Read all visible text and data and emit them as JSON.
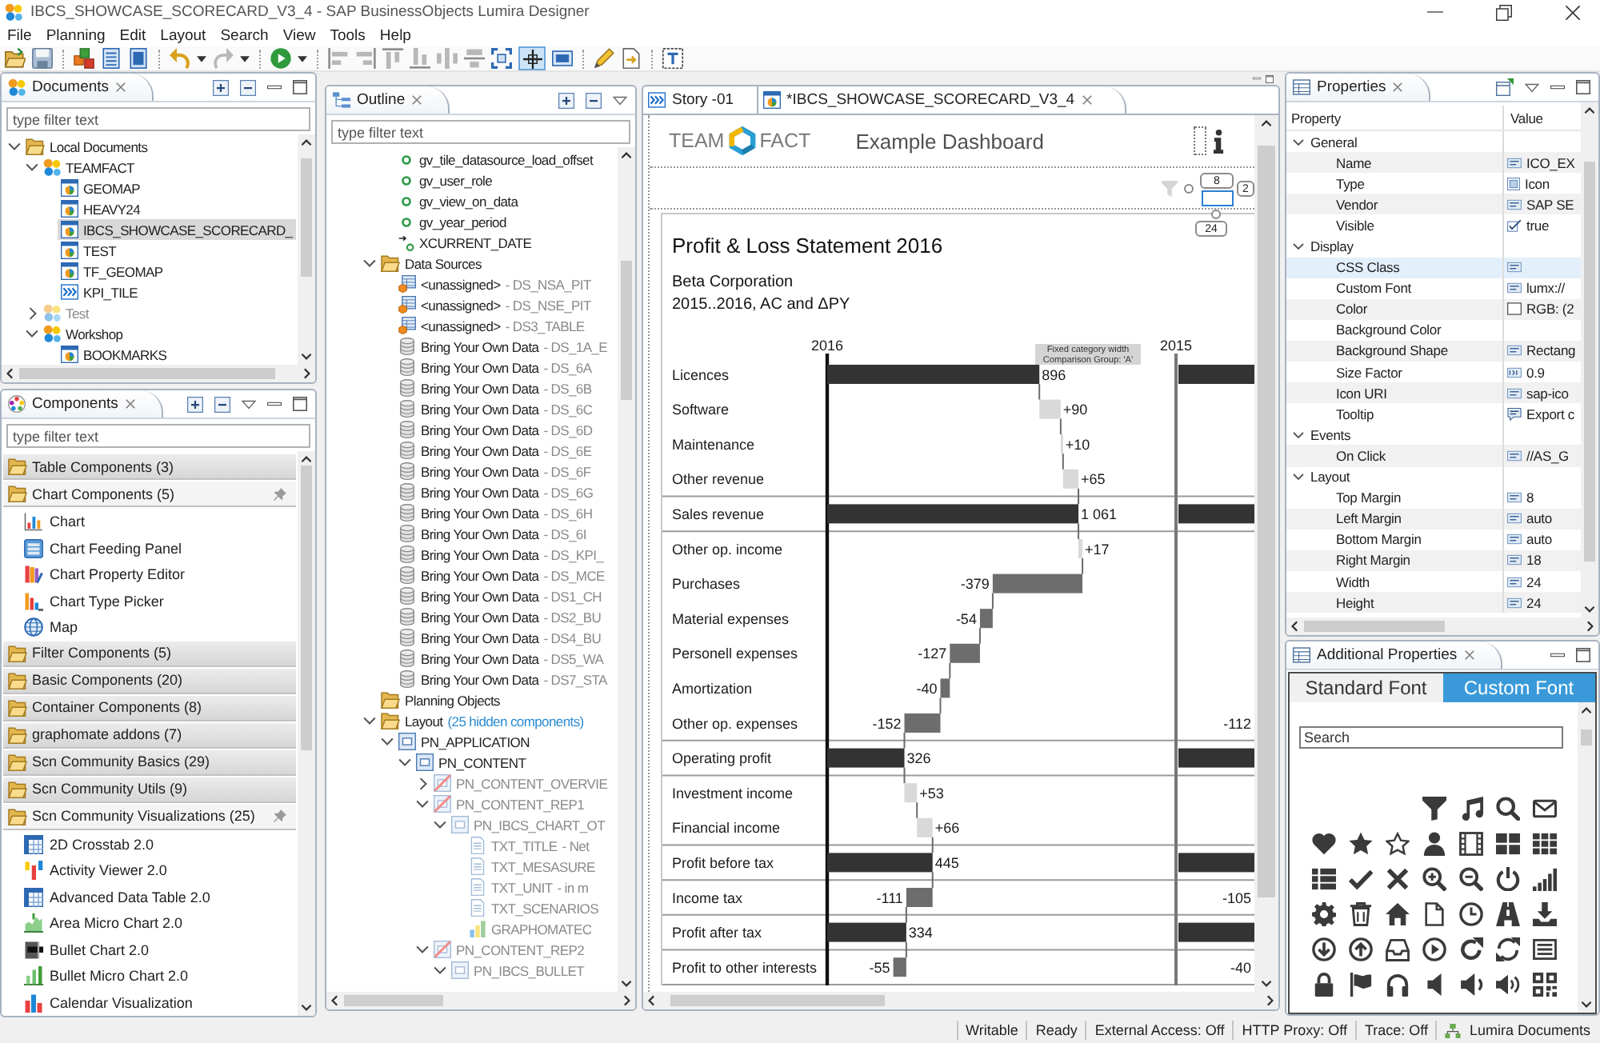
{
  "window": {
    "title": "IBCS_SHOWCASE_SCORECARD_V3_4 - SAP BusinessObjects Lumira Designer"
  },
  "menu": [
    "File",
    "Planning",
    "Edit",
    "Layout",
    "Search",
    "View",
    "Tools",
    "Help"
  ],
  "toolbar": {
    "toggle": {
      "on": true
    }
  },
  "documents": {
    "title": "Documents",
    "filter": {
      "placeholder": "type filter text"
    },
    "tree": [
      {
        "label": "Local Documents",
        "kind": "folder",
        "expanded": true,
        "selected": false,
        "children": [
          {
            "label": "TEAMFACT",
            "kind": "group",
            "expanded": true,
            "selected": false,
            "disabled": false,
            "children": [
              {
                "label": "GEOMAP",
                "kind": "app",
                "selected": false
              },
              {
                "label": "HEAVY24",
                "kind": "app",
                "selected": false
              },
              {
                "label": "IBCS_SHOWCASE_SCORECARD_",
                "kind": "app",
                "selected": true
              },
              {
                "label": "TEST",
                "kind": "app",
                "selected": false
              },
              {
                "label": "TF_GEOMAP",
                "kind": "app",
                "selected": false
              },
              {
                "label": "KPI_TILE",
                "kind": "story",
                "selected": false
              }
            ]
          },
          {
            "label": "Test",
            "kind": "group",
            "expanded": false,
            "selected": false,
            "disabled": true
          },
          {
            "label": "Workshop",
            "kind": "group",
            "expanded": true,
            "selected": false,
            "disabled": false,
            "children": [
              {
                "label": "BOOKMARKS",
                "kind": "app",
                "selected": false
              }
            ]
          }
        ]
      }
    ]
  },
  "components": {
    "title": "Components",
    "filter": {
      "placeholder": "type filter text"
    },
    "categories": [
      {
        "label": "Table Components (3)",
        "expanded": false
      },
      {
        "label": "Chart Components (5)",
        "expanded": true,
        "items": [
          {
            "label": "Chart",
            "kind": "chart"
          },
          {
            "label": "Chart Feeding Panel",
            "kind": "feeding-panel"
          },
          {
            "label": "Chart Property Editor",
            "kind": "property-editor"
          },
          {
            "label": "Chart Type Picker",
            "kind": "type-picker"
          },
          {
            "label": "Map",
            "kind": "map"
          }
        ]
      },
      {
        "label": "Filter Components (5)",
        "expanded": false
      },
      {
        "label": "Basic Components (20)",
        "expanded": false
      },
      {
        "label": "Container Components (8)",
        "expanded": false
      },
      {
        "label": "graphomate addons (7)",
        "expanded": false
      },
      {
        "label": "Scn Community Basics (29)",
        "expanded": false
      },
      {
        "label": "Scn Community Utils (9)",
        "expanded": false
      },
      {
        "label": "Scn Community Visualizations (25)",
        "expanded": true,
        "items": [
          {
            "label": "2D Crosstab 2.0",
            "kind": "crosstab"
          },
          {
            "label": "Activity Viewer 2.0",
            "kind": "activity-viewer"
          },
          {
            "label": "Advanced Data Table 2.0",
            "kind": "data-table"
          },
          {
            "label": "Area Micro Chart 2.0",
            "kind": "area-micro-chart"
          },
          {
            "label": "Bullet Chart 2.0",
            "kind": "bullet-chart"
          },
          {
            "label": "Bullet Micro Chart 2.0",
            "kind": "bullet-micro-chart"
          },
          {
            "label": "Calendar Visualization",
            "kind": "calendar"
          }
        ]
      }
    ]
  },
  "outline": {
    "title": "Outline",
    "filter": {
      "placeholder": "type filter text"
    },
    "tree": [
      {
        "children": [
          {
            "label": "gv_tile_datasource_load_offset",
            "kind": "variable"
          },
          {
            "label": "gv_user_role",
            "kind": "variable"
          },
          {
            "label": "gv_view_on_data",
            "kind": "variable"
          },
          {
            "label": "gv_year_period",
            "kind": "variable"
          },
          {
            "label": "XCURRENT_DATE",
            "kind": "computed-variable"
          }
        ]
      },
      {
        "label": "Data Sources",
        "kind": "folder",
        "expanded": true,
        "children": [
          {
            "label": "<unassigned>",
            "detail": "- DS_NSA_PIT",
            "kind": "datasource-unassigned"
          },
          {
            "label": "<unassigned>",
            "detail": "- DS_NSE_PIT",
            "kind": "datasource-unassigned"
          },
          {
            "label": "<unassigned>",
            "detail": "- DS3_TABLE",
            "kind": "datasource-unassigned"
          },
          {
            "label": "Bring Your Own Data",
            "detail": "- DS_1A_E",
            "kind": "datasource"
          },
          {
            "label": "Bring Your Own Data",
            "detail": "- DS_6A",
            "kind": "datasource"
          },
          {
            "label": "Bring Your Own Data",
            "detail": "- DS_6B",
            "kind": "datasource"
          },
          {
            "label": "Bring Your Own Data",
            "detail": "- DS_6C",
            "kind": "datasource"
          },
          {
            "label": "Bring Your Own Data",
            "detail": "- DS_6D",
            "kind": "datasource"
          },
          {
            "label": "Bring Your Own Data",
            "detail": "- DS_6E",
            "kind": "datasource"
          },
          {
            "label": "Bring Your Own Data",
            "detail": "- DS_6F",
            "kind": "datasource"
          },
          {
            "label": "Bring Your Own Data",
            "detail": "- DS_6G",
            "kind": "datasource"
          },
          {
            "label": "Bring Your Own Data",
            "detail": "- DS_6H",
            "kind": "datasource"
          },
          {
            "label": "Bring Your Own Data",
            "detail": "- DS_6I",
            "kind": "datasource"
          },
          {
            "label": "Bring Your Own Data",
            "detail": "- DS_KPI_",
            "kind": "datasource"
          },
          {
            "label": "Bring Your Own Data",
            "detail": "- DS_MCE",
            "kind": "datasource"
          },
          {
            "label": "Bring Your Own Data",
            "detail": "- DS1_CH",
            "kind": "datasource"
          },
          {
            "label": "Bring Your Own Data",
            "detail": "- DS2_BU",
            "kind": "datasource"
          },
          {
            "label": "Bring Your Own Data",
            "detail": "- DS4_BU",
            "kind": "datasource"
          },
          {
            "label": "Bring Your Own Data",
            "detail": "- DS5_WA",
            "kind": "datasource"
          },
          {
            "label": "Bring Your Own Data",
            "detail": "- DS7_STA",
            "kind": "datasource"
          }
        ]
      },
      {
        "label": "Planning Objects",
        "kind": "folder"
      },
      {
        "label": "Layout",
        "note": "(25 hidden components)",
        "kind": "folder",
        "expanded": true,
        "children": [
          {
            "label": "PN_APPLICATION",
            "kind": "panel",
            "expanded": true,
            "disabled": false,
            "children": [
              {
                "label": "PN_CONTENT",
                "kind": "panel",
                "expanded": true,
                "disabled": false,
                "children": [
                  {
                    "label": "PN_CONTENT_OVERVIE",
                    "kind": "hidden-panel",
                    "expanded": false,
                    "disabled": true
                  },
                  {
                    "label": "PN_CONTENT_REP1",
                    "kind": "hidden-panel",
                    "expanded": true,
                    "disabled": true,
                    "children": [
                      {
                        "label": "PN_IBCS_CHART_OT",
                        "kind": "panel",
                        "expanded": true,
                        "disabled": true,
                        "children": [
                          {
                            "label": "TXT_TITLE",
                            "detail": "- Net",
                            "kind": "text",
                            "disabled": true
                          },
                          {
                            "label": "TXT_MESASURE",
                            "kind": "text",
                            "disabled": true
                          },
                          {
                            "label": "TXT_UNIT",
                            "detail": "- in m",
                            "kind": "text",
                            "disabled": true
                          },
                          {
                            "label": "TXT_SCENARIOS",
                            "kind": "text",
                            "disabled": true
                          },
                          {
                            "label": "GRAPHOMATEC",
                            "kind": "chart",
                            "disabled": true
                          }
                        ]
                      }
                    ]
                  },
                  {
                    "label": "PN_CONTENT_REP2",
                    "kind": "hidden-panel",
                    "expanded": true,
                    "disabled": true,
                    "children": [
                      {
                        "label": "PN_IBCS_BULLET",
                        "kind": "panel",
                        "expanded": true,
                        "disabled": true
                      }
                    ]
                  }
                ]
              }
            ]
          }
        ]
      }
    ]
  },
  "editor": {
    "tabs": [
      {
        "label": "Story -01",
        "kind": "story",
        "selected": false
      },
      {
        "label": "*IBCS_SHOWCASE_SCORECARD_V3_4",
        "kind": "app",
        "selected": true
      }
    ],
    "dashboard": {
      "logo": [
        "TEAM",
        "FACT"
      ],
      "title": "Example Dashboard",
      "handle_labels": [
        "8",
        "2",
        "24"
      ],
      "report": {
        "title": "Profit & Loss Statement 2016",
        "subtitle": [
          "Beta Corporation",
          "2015..2016, AC and ΔPY"
        ],
        "columns": [
          "2016",
          "2015"
        ],
        "annotation": [
          "Fixed category width",
          "Comparison Group: 'A'"
        ],
        "rows": [
          {
            "label": "Licences",
            "kind": "total",
            "values": [
              "896"
            ]
          },
          {
            "label": "Software",
            "kind": "delta",
            "values": [
              "+90"
            ]
          },
          {
            "label": "Maintenance",
            "kind": "delta",
            "values": [
              "+10"
            ]
          },
          {
            "label": "Other revenue",
            "kind": "delta",
            "values": [
              "+65"
            ]
          },
          {
            "label": "Sales revenue",
            "kind": "total",
            "values": [
              "1 061"
            ]
          },
          {
            "label": "Other op. income",
            "kind": "delta",
            "values": [
              "+17"
            ]
          },
          {
            "label": "Purchases",
            "kind": "delta",
            "values": [
              "-379"
            ]
          },
          {
            "label": "Material expenses",
            "kind": "delta",
            "values": [
              "-54"
            ]
          },
          {
            "label": "Personell expenses",
            "kind": "delta",
            "values": [
              "-127"
            ]
          },
          {
            "label": "Amortization",
            "kind": "delta",
            "values": [
              "-40"
            ]
          },
          {
            "label": "Other op. expenses",
            "kind": "delta",
            "values": [
              "-152",
              "-112"
            ]
          },
          {
            "label": "Operating profit",
            "kind": "total",
            "values": [
              "326"
            ]
          },
          {
            "label": "Investment income",
            "kind": "delta",
            "values": [
              "+53"
            ]
          },
          {
            "label": "Financial income",
            "kind": "delta",
            "values": [
              "+66"
            ]
          },
          {
            "label": "Profit before tax",
            "kind": "total",
            "values": [
              "445"
            ]
          },
          {
            "label": "Income tax",
            "kind": "delta",
            "values": [
              "-111",
              "-105"
            ]
          },
          {
            "label": "Profit after tax",
            "kind": "total",
            "values": [
              "334"
            ]
          },
          {
            "label": "Profit to other interests",
            "kind": "delta",
            "values": [
              "-55",
              "-40"
            ]
          }
        ]
      }
    }
  },
  "properties": {
    "title": "Properties",
    "columns": [
      "Property",
      "Value"
    ],
    "groups": [
      {
        "label": "General",
        "expanded": true,
        "rows": [
          {
            "name": "Name",
            "value": "ICO_EX",
            "kind": "text",
            "selected": false
          },
          {
            "name": "Type",
            "value": "Icon",
            "kind": "type",
            "selected": false
          },
          {
            "name": "Vendor",
            "value": "SAP SE",
            "kind": "text",
            "selected": false
          },
          {
            "name": "Visible",
            "value": "true",
            "kind": "boolean",
            "selected": false
          }
        ]
      },
      {
        "label": "Display",
        "expanded": true,
        "rows": [
          {
            "name": "CSS Class",
            "kind": "text",
            "selected": true
          },
          {
            "name": "Custom Font",
            "value": "lumx://",
            "kind": "text",
            "selected": false
          },
          {
            "name": "Color",
            "value": "RGB: (2",
            "kind": "color",
            "selected": false
          },
          {
            "name": "Background Color",
            "kind": "none",
            "selected": false
          },
          {
            "name": "Background Shape",
            "value": "Rectang",
            "kind": "text",
            "selected": false
          },
          {
            "name": "Size Factor",
            "value": "0.9",
            "kind": "number",
            "selected": false
          },
          {
            "name": "Icon URI",
            "value": "sap-ico",
            "kind": "text",
            "selected": false
          },
          {
            "name": "Tooltip",
            "value": "Export c",
            "kind": "tooltip",
            "selected": false
          }
        ]
      },
      {
        "label": "Events",
        "expanded": true,
        "rows": [
          {
            "name": "On Click",
            "value": "//AS_G",
            "kind": "text",
            "selected": false
          }
        ]
      },
      {
        "label": "Layout",
        "expanded": true,
        "rows": [
          {
            "name": "Top Margin",
            "value": "8",
            "kind": "text",
            "selected": false
          },
          {
            "name": "Left Margin",
            "value": "auto",
            "kind": "text",
            "selected": false
          },
          {
            "name": "Bottom Margin",
            "value": "auto",
            "kind": "text",
            "selected": false
          },
          {
            "name": "Right Margin",
            "value": "18",
            "kind": "text",
            "selected": false
          },
          {
            "name": "Width",
            "value": "24",
            "kind": "text",
            "selected": false
          },
          {
            "name": "Height",
            "value": "24",
            "kind": "text",
            "selected": false
          }
        ]
      }
    ]
  },
  "additional_properties": {
    "title": "Additional Properties",
    "tabs": [
      {
        "label": "Standard Font",
        "selected": false
      },
      {
        "label": "Custom Font",
        "selected": true
      }
    ],
    "search": {
      "placeholder": "Search"
    }
  },
  "status_bar": {
    "fields": [
      "Writable",
      "Ready",
      "External Access: Off",
      "HTTP Proxy: Off",
      "Trace: Off"
    ],
    "documents": "Lumira Documents"
  }
}
